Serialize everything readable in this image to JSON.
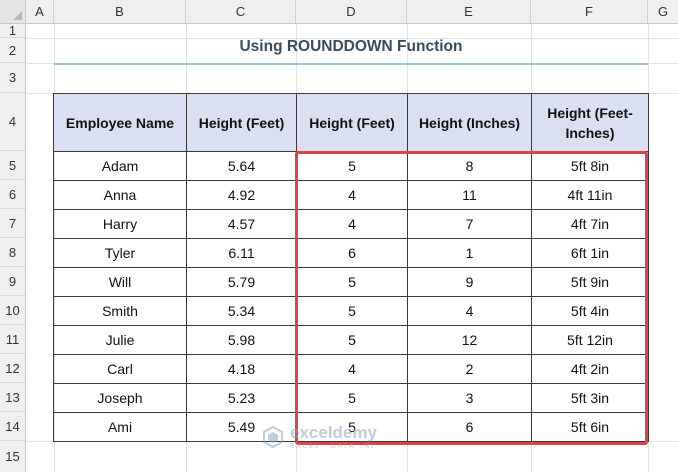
{
  "columns": [
    "A",
    "B",
    "C",
    "D",
    "E",
    "F",
    "G"
  ],
  "rows": [
    "1",
    "2",
    "3",
    "4",
    "5",
    "6",
    "7",
    "8",
    "9",
    "10",
    "11",
    "12",
    "13",
    "14",
    "15"
  ],
  "title": "Using ROUNDDOWN Function",
  "table": {
    "headers": [
      "Employee Name",
      "Height (Feet)",
      "Height (Feet)",
      "Height (Inches)",
      "Height (Feet-Inches)"
    ],
    "rows": [
      [
        "Adam",
        "5.64",
        "5",
        "8",
        "5ft 8in"
      ],
      [
        "Anna",
        "4.92",
        "4",
        "11",
        "4ft 11in"
      ],
      [
        "Harry",
        "4.57",
        "4",
        "7",
        "4ft 7in"
      ],
      [
        "Tyler",
        "6.11",
        "6",
        "1",
        "6ft 1in"
      ],
      [
        "Will",
        "5.79",
        "5",
        "9",
        "5ft 9in"
      ],
      [
        "Smith",
        "5.34",
        "5",
        "4",
        "5ft 4in"
      ],
      [
        "Julie",
        "5.98",
        "5",
        "12",
        "5ft 12in"
      ],
      [
        "Carl",
        "4.18",
        "4",
        "2",
        "4ft 2in"
      ],
      [
        "Joseph",
        "5.23",
        "5",
        "3",
        "5ft 3in"
      ],
      [
        "Ami",
        "5.49",
        "5",
        "6",
        "5ft 6in"
      ]
    ]
  },
  "highlight_color": "#e04148",
  "header_fill": "#dae0f1",
  "watermark": {
    "name": "exceldemy",
    "tagline": "EXCEL · DATA · BI"
  }
}
